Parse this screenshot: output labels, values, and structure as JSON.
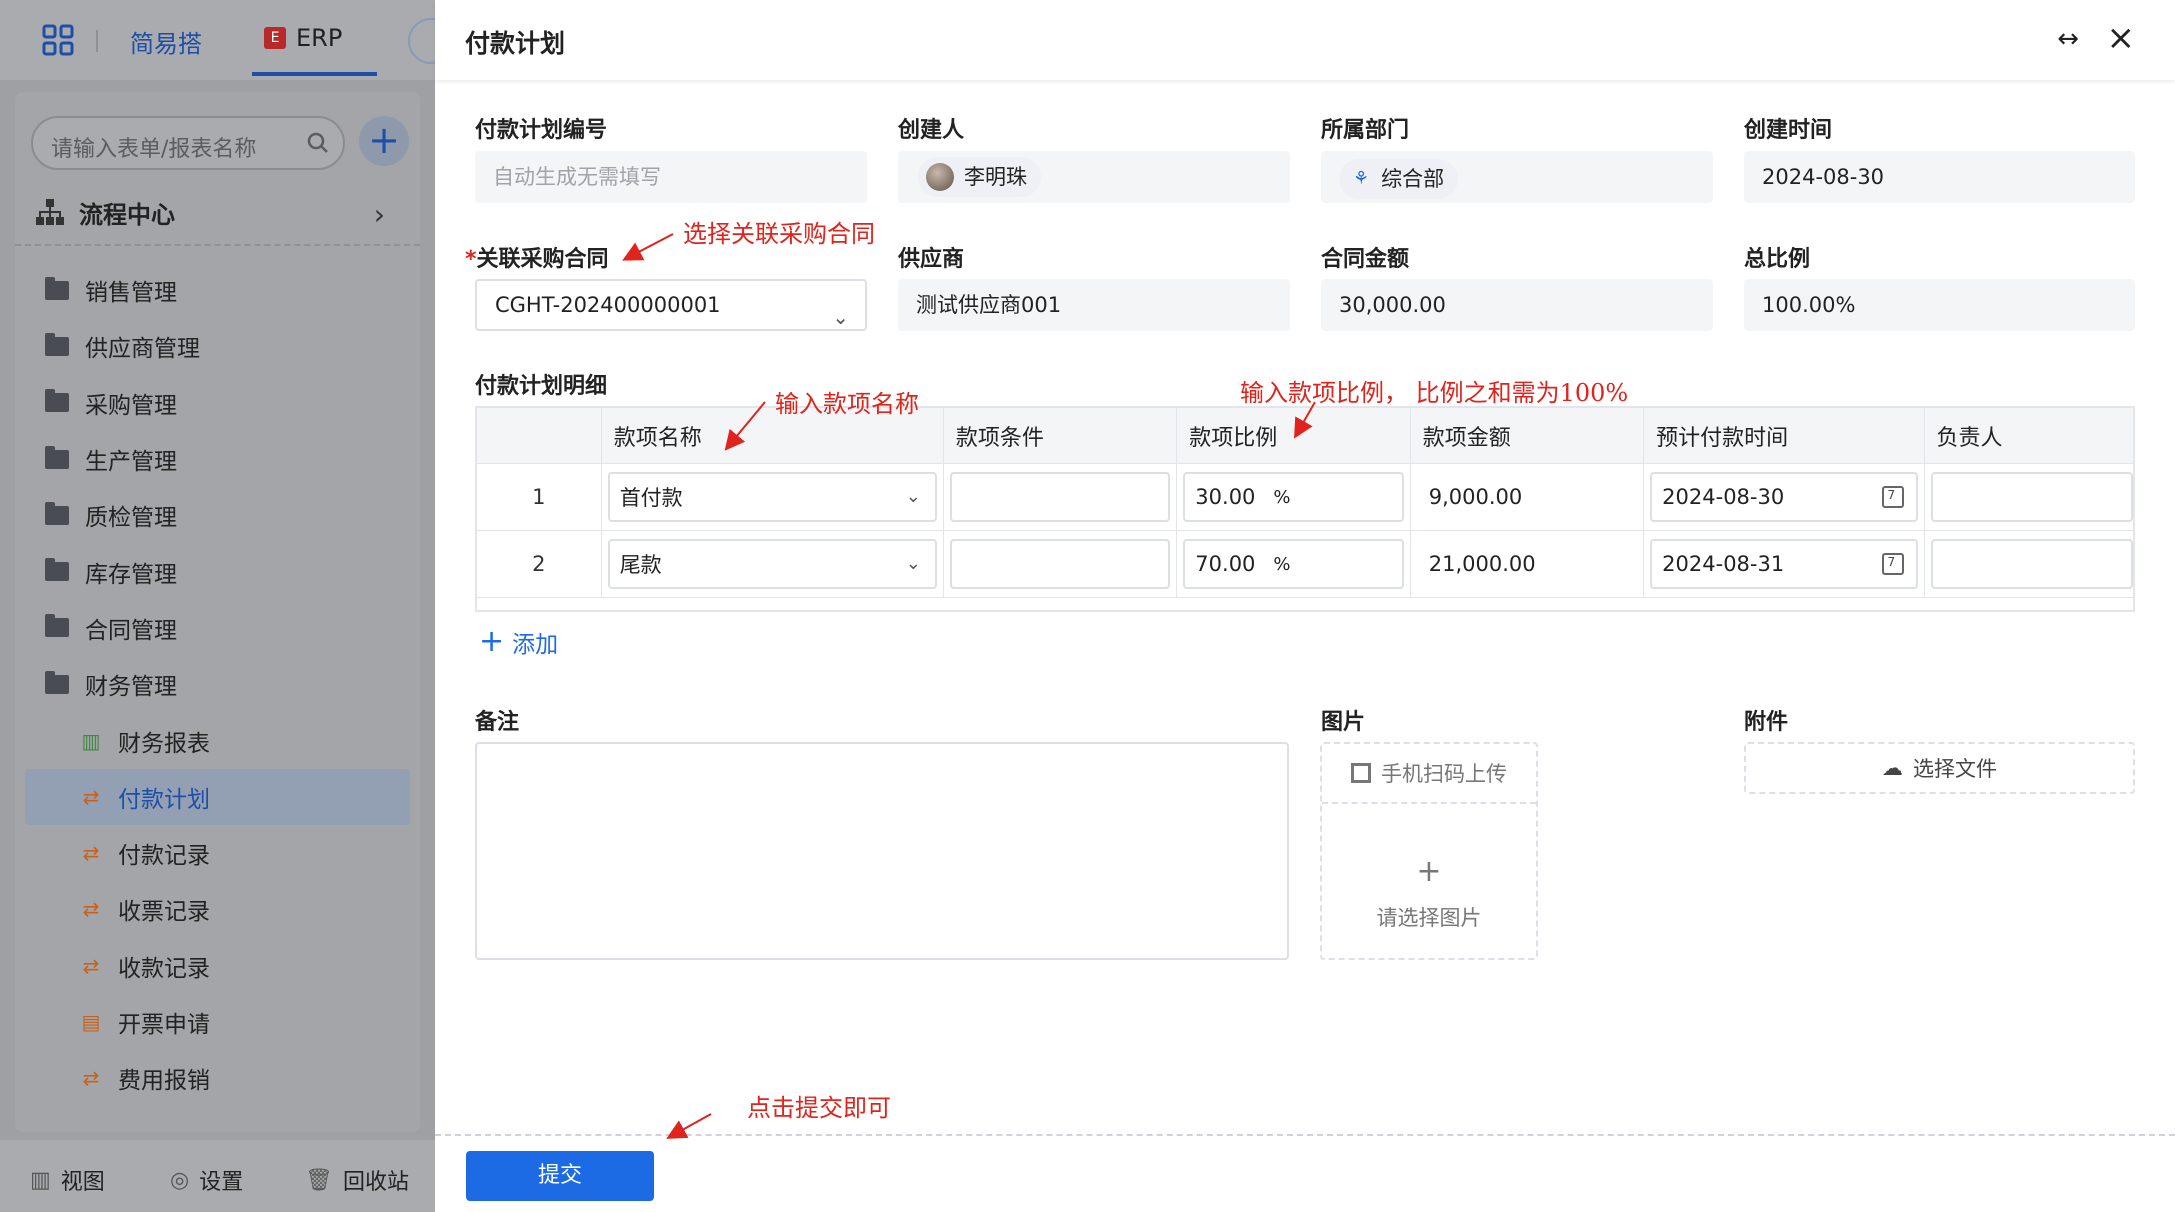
{
  "app": {
    "tabs": [
      "简易搭",
      "ERP"
    ],
    "erp_icon_text": "E",
    "search_placeholder": "请输入表单/报表名称",
    "flow_center": "流程中心",
    "menu": [
      {
        "label": "销售管理",
        "type": "folder"
      },
      {
        "label": "供应商管理",
        "type": "folder"
      },
      {
        "label": "采购管理",
        "type": "folder"
      },
      {
        "label": "生产管理",
        "type": "folder"
      },
      {
        "label": "质检管理",
        "type": "folder"
      },
      {
        "label": "库存管理",
        "type": "folder"
      },
      {
        "label": "合同管理",
        "type": "folder"
      },
      {
        "label": "财务管理",
        "type": "folder-open"
      },
      {
        "label": "财务报表",
        "type": "sub"
      },
      {
        "label": "付款计划",
        "type": "sub",
        "active": true
      },
      {
        "label": "付款记录",
        "type": "sub"
      },
      {
        "label": "收票记录",
        "type": "sub"
      },
      {
        "label": "收款记录",
        "type": "sub"
      },
      {
        "label": "开票申请",
        "type": "sub"
      },
      {
        "label": "费用报销",
        "type": "sub"
      }
    ],
    "bottom": {
      "view": "视图",
      "settings": "设置",
      "recycle": "回收站"
    }
  },
  "panel": {
    "title": "付款计划",
    "fields": {
      "plan_no": {
        "label": "付款计划编号",
        "placeholder": "自动生成无需填写"
      },
      "creator": {
        "label": "创建人",
        "value": "李明珠"
      },
      "dept": {
        "label": "所属部门",
        "value": "综合部"
      },
      "created_at": {
        "label": "创建时间",
        "value": "2024-08-30"
      },
      "contract": {
        "label": "关联采购合同",
        "required_mark": "*",
        "value": "CGHT-202400000001"
      },
      "supplier": {
        "label": "供应商",
        "value": "测试供应商001"
      },
      "amount": {
        "label": "合同金额",
        "value": "30,000.00"
      },
      "ratio": {
        "label": "总比例",
        "value": "100.00%"
      }
    },
    "detail": {
      "label": "付款计划明细",
      "columns": [
        "",
        "款项名称",
        "款项条件",
        "款项比例",
        "款项金额",
        "预计付款时间",
        "负责人"
      ],
      "rows": [
        {
          "idx": "1",
          "name": "首付款",
          "cond": "",
          "ratio": "30.00",
          "unit": "%",
          "amount": "9,000.00",
          "date": "2024-08-30",
          "owner": ""
        },
        {
          "idx": "2",
          "name": "尾款",
          "cond": "",
          "ratio": "70.00",
          "unit": "%",
          "amount": "21,000.00",
          "date": "2024-08-31",
          "owner": ""
        }
      ],
      "add_label": "添加"
    },
    "remark_label": "备注",
    "image_label": "图片",
    "image_scan": "手机扫码上传",
    "image_choose": "请选择图片",
    "attach_label": "附件",
    "attach_button": "选择文件",
    "submit": "提交"
  },
  "annotations": {
    "contract": "选择关联采购合同",
    "name": "输入款项名称",
    "ratio": "输入款项比例，  比例之和需为100%",
    "submit": "点击提交即可"
  },
  "colors": {
    "primary": "#1d6ae5",
    "annotation": "#e0231c",
    "required": "#d6261f"
  }
}
